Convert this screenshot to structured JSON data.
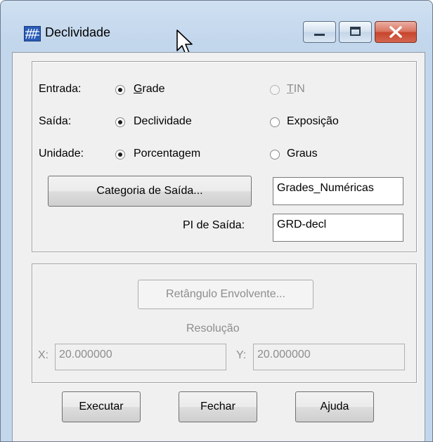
{
  "window": {
    "title": "Declividade"
  },
  "entrada": {
    "label": "Entrada:",
    "opt1": "Grade",
    "opt2": "TIN",
    "opt1_accel": "G",
    "opt2_accel": "T"
  },
  "saida": {
    "label": "Saída:",
    "opt1": "Declividade",
    "opt2": "Exposição"
  },
  "unidade": {
    "label": "Unidade:",
    "opt1": "Porcentagem",
    "opt2": "Graus"
  },
  "categoria": {
    "button_label": "Categoria de Saída...",
    "value": "Grades_Numéricas"
  },
  "pi": {
    "label": "PI de Saída:",
    "value": "GRD-decl"
  },
  "retangulo": {
    "button_label": "Retângulo Envolvente..."
  },
  "resolucao": {
    "label": "Resolução",
    "x_label": "X:",
    "x_value": "20.000000",
    "y_label": "Y:",
    "y_value": "20.000000"
  },
  "actions": {
    "executar": "Executar",
    "fechar": "Fechar",
    "ajuda": "Ajuda"
  }
}
